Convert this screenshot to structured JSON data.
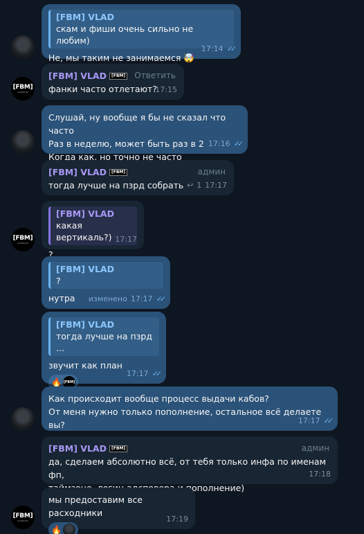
{
  "messages": {
    "m1": {
      "quote_name": "[FBM] VLAD",
      "quote_text": "скам и фиши очень сильно не любим)",
      "text": "Не, мы таким не занимаемся 🤯",
      "time": "17:14"
    },
    "m2": {
      "sender": "[FBM] VLAD",
      "badge": "[FBM]",
      "action": "Ответить",
      "text": "фанки часто отлетают?",
      "time": "17:15"
    },
    "m3": {
      "text": "Слушай, ну вообще я бы не сказал что часто\nРаз в неделю, может быть раз в 2\nКогда как, но точно не часто",
      "time": "17:16"
    },
    "m4": {
      "sender": "[FBM] VLAD",
      "badge": "[FBM]",
      "role": "админ",
      "text": "тогда лучше на пзрд собрать",
      "replies": "1",
      "time": "17:17"
    },
    "m5": {
      "quote_name": "[FBM] VLAD",
      "quote_text": "какая вертикаль?)",
      "text": "?",
      "time": "17:17"
    },
    "m6": {
      "quote_name": "[FBM] VLAD",
      "quote_text": "?",
      "text": "нутра",
      "edited": "изменено",
      "time": "17:17"
    },
    "m7": {
      "quote_name": "[FBM] VLAD",
      "quote_text": "тогда лучше на пзрд ...",
      "text": "звучит как план",
      "reaction_logo": "[FBM]",
      "time": "17:17"
    },
    "m8": {
      "text": "Как происходит вообще процесс выдачи кабов?\nОт меня нужно только пополнение, остальное всё делаете вы?",
      "time": "17:17"
    },
    "m9": {
      "sender": "[FBM] VLAD",
      "badge": "[FBM]",
      "role": "админ",
      "text": "да, сделаем абсолютно всё, от тебя только инфа по именам фп,\nтаймзоне, логин адсповера и пополнение)",
      "time": "17:18"
    },
    "m10": {
      "text": "мы предоставим все расходники",
      "time": "17:19"
    }
  },
  "avatar_logo": {
    "main": "[FBM]",
    "sub": "VLADSLAV"
  },
  "colors": {
    "background": "#0e1621",
    "outgoing": "#2b5278",
    "incoming": "#182533",
    "accent": "#6ab3f3",
    "sender": "#a898f4"
  },
  "icons": {
    "read": "double-check-icon",
    "reply": "reply-arrow-icon",
    "reaction": "fire-icon"
  }
}
